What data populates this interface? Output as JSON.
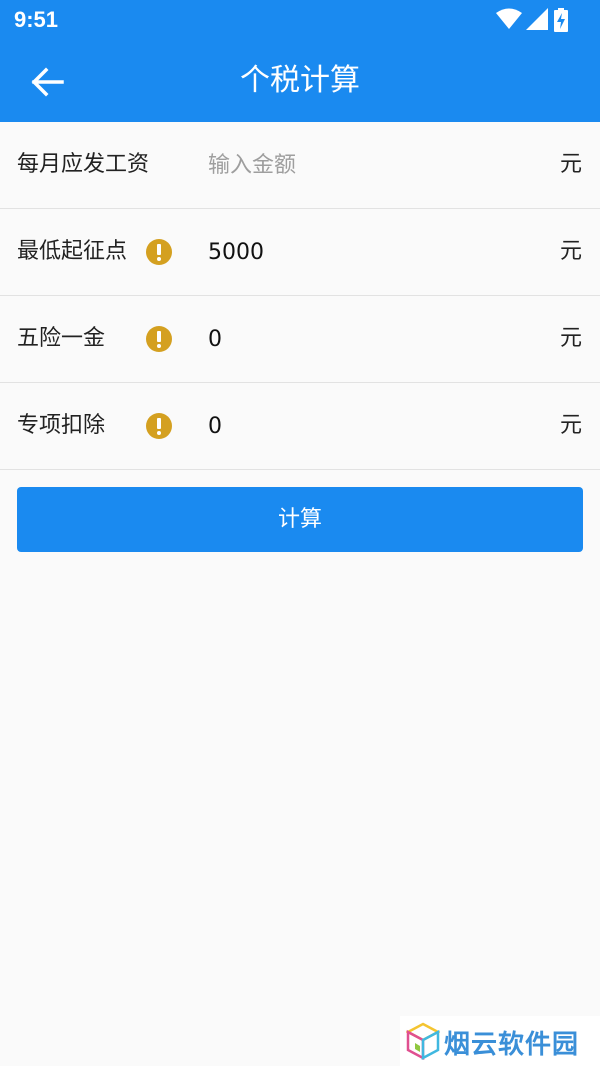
{
  "status_bar": {
    "time": "9:51",
    "icons": [
      "wifi-icon",
      "signal-icon",
      "battery-charging-icon"
    ]
  },
  "app_bar": {
    "back_icon": "arrow-left-icon",
    "title": "个税计算"
  },
  "form": {
    "rows": [
      {
        "label": "每月应发工资",
        "value": "",
        "placeholder": "输入金额",
        "unit": "元",
        "has_info": false
      },
      {
        "label": "最低起征点",
        "value": "5000",
        "placeholder": "",
        "unit": "元",
        "has_info": true
      },
      {
        "label": "五险一金",
        "value": "0",
        "placeholder": "",
        "unit": "元",
        "has_info": true
      },
      {
        "label": "专项扣除",
        "value": "0",
        "placeholder": "",
        "unit": "元",
        "has_info": true
      }
    ]
  },
  "calculate_button": {
    "label": "计算"
  },
  "watermark": {
    "text": "烟云软件园"
  },
  "colors": {
    "primary": "#1a8af0",
    "info_icon": "#d4a020",
    "background": "#fafafa",
    "placeholder": "#9e9e9e"
  }
}
